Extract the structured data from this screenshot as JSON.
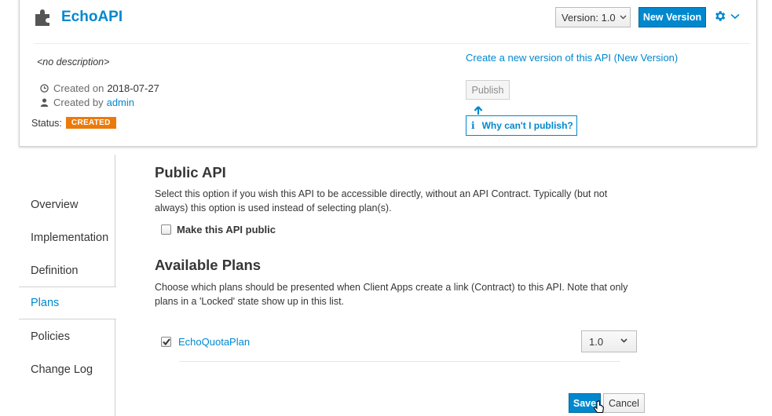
{
  "header": {
    "title": "EchoAPI",
    "version_label": "Version: 1.0",
    "new_version_label": "New Version",
    "description": "<no description>",
    "created_on_label": "Created on",
    "created_on_value": "2018-07-27",
    "created_by_label": "Created by",
    "created_by_value": "admin",
    "status_label": "Status:",
    "status_value": "CREATED",
    "create_version_link": "Create a new version of this API (New Version)",
    "publish_label": "Publish",
    "why_publish_label": "Why can't I publish?",
    "icons": [
      "puzzle-icon",
      "gear-icon",
      "chevron-down-icon",
      "clock-icon",
      "user-icon",
      "arrow-up-icon",
      "info-icon"
    ]
  },
  "sidebar": {
    "items": [
      {
        "label": "Overview",
        "active": false
      },
      {
        "label": "Implementation",
        "active": false
      },
      {
        "label": "Definition",
        "active": false
      },
      {
        "label": "Plans",
        "active": true
      },
      {
        "label": "Policies",
        "active": false
      },
      {
        "label": "Change Log",
        "active": false
      }
    ]
  },
  "public_api": {
    "title": "Public API",
    "description": "Select this option if you wish this API to be accessible directly, without an API Contract. Typically (but not always) this option is used instead of selecting plan(s).",
    "checkbox_label": "Make this API public",
    "checked": false
  },
  "plans": {
    "title": "Available Plans",
    "description": "Choose which plans should be presented when Client Apps create a link (Contract) to this API. Note that only plans in a 'Locked' state show up in this list.",
    "items": [
      {
        "name": "EchoQuotaPlan",
        "checked": true,
        "version": "1.0"
      }
    ]
  },
  "actions": {
    "save_label": "Save",
    "cancel_label": "Cancel"
  },
  "colors": {
    "accent": "#0088ce",
    "status_badge": "#ec7a08"
  }
}
